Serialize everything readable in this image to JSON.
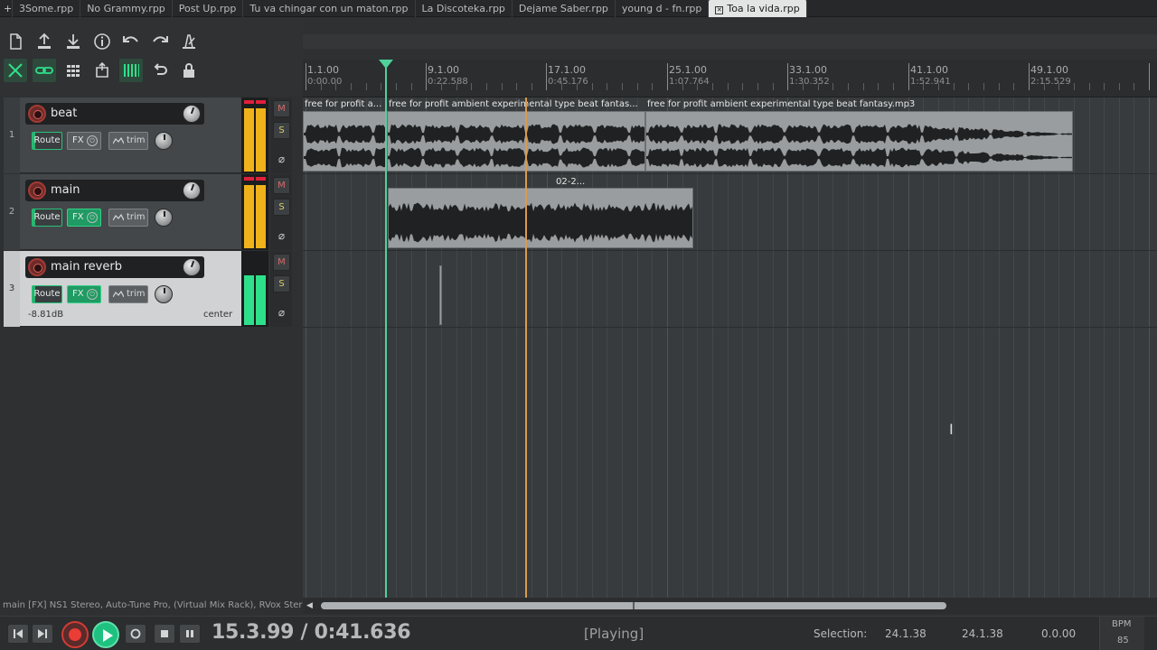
{
  "tabs": [
    {
      "label": "3Some.rpp"
    },
    {
      "label": "No Grammy.rpp"
    },
    {
      "label": "Post Up.rpp"
    },
    {
      "label": "Tu va chingar con un maton.rpp"
    },
    {
      "label": "La Discoteka.rpp"
    },
    {
      "label": "Dejame Saber.rpp"
    },
    {
      "label": "young d - fn.rpp"
    },
    {
      "label": "Toa la vida.rpp"
    }
  ],
  "toolbar": {
    "icons": [
      "new-project-icon",
      "save-project-icon",
      "open-project-icon",
      "info-icon",
      "undo-icon",
      "redo-icon",
      "metronome-icon",
      "ripple-edit-icon",
      "grouping-icon",
      "snap-grid-icon",
      "item-group-icon",
      "grid-icon",
      "loop-icon",
      "lock-icon"
    ]
  },
  "ruler": {
    "markers": [
      {
        "bar": "1.1.00",
        "time": "0:00.00"
      },
      {
        "bar": "9.1.00",
        "time": "0:22.588"
      },
      {
        "bar": "17.1.00",
        "time": "0:45.176"
      },
      {
        "bar": "25.1.00",
        "time": "1:07.764"
      },
      {
        "bar": "33.1.00",
        "time": "1:30.352"
      },
      {
        "bar": "41.1.00",
        "time": "1:52.941"
      },
      {
        "bar": "49.1.00",
        "time": "2:15.529"
      }
    ]
  },
  "tracks": [
    {
      "number": "1",
      "name": "beat",
      "route": "Route",
      "fx": "FX",
      "trim": "trim",
      "mute": "M",
      "solo": "S",
      "phase": "⌀"
    },
    {
      "number": "2",
      "name": "main",
      "route": "Route",
      "fx": "FX",
      "trim": "trim",
      "mute": "M",
      "solo": "S",
      "phase": "⌀"
    },
    {
      "number": "3",
      "name": "main reverb",
      "route": "Route",
      "fx": "FX",
      "trim": "trim",
      "mute": "M",
      "solo": "S",
      "phase": "⌀",
      "volume": "-8.81dB",
      "pan": "center"
    }
  ],
  "items": [
    {
      "title": "free for profit a..."
    },
    {
      "title": "free for profit ambient  experimental type beat fantas..."
    },
    {
      "title": "free for profit ambient  experimental type beat fantasy.mp3"
    },
    {
      "title": "02-2..."
    }
  ],
  "status": {
    "fx_chain": "main [FX] NS1 Stereo, Auto-Tune Pro, (Virtual Mix Rack), RVox Stere"
  },
  "transport": {
    "position": "15.3.99 / 0:41.636",
    "state": "[Playing]",
    "selection_label": "Selection:",
    "selection_start": "24.1.38",
    "selection_end": "24.1.38",
    "selection_length": "0.0.00",
    "bpm_label": "BPM",
    "bpm_value": "85"
  },
  "colors": {
    "edit_cursor": "#4fd19a",
    "play_cursor": "#d99a4c",
    "record": "#ea3d35",
    "play": "#1fc180",
    "meter_yellow": "#f0b21a",
    "meter_green": "#2fe08a"
  }
}
